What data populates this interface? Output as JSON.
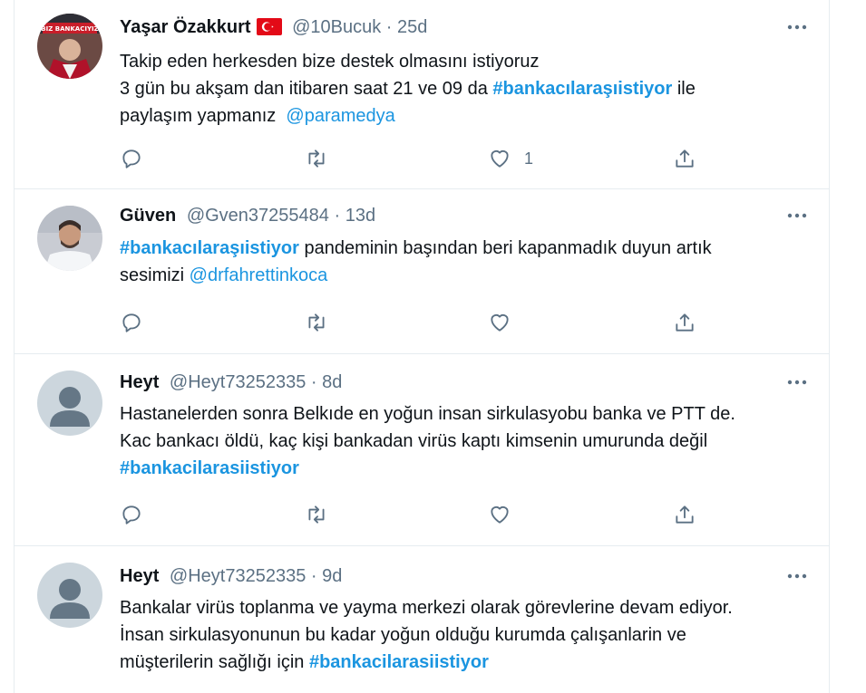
{
  "colors": {
    "link": "#1b95e0",
    "secondary": "#5b7083",
    "border": "#e6ecf0"
  },
  "tweets": [
    {
      "name": "Yaşar Özakkurt",
      "has_flag": true,
      "handle": "@10Bucuk",
      "time": "25d",
      "lines": [
        [
          {
            "t": "text",
            "v": "Takip eden herkesden bize destek olmasını istiyoruz"
          }
        ],
        [
          {
            "t": "text",
            "v": "3 gün bu akşam dan itibaren saat 21 ve 09 da "
          },
          {
            "t": "tag",
            "v": "#bankacılaraşıistiyor"
          },
          {
            "t": "text",
            "v": " ile"
          }
        ],
        [
          {
            "t": "text",
            "v": "paylaşım yapmanız  "
          },
          {
            "t": "mention",
            "v": "@paramedya"
          }
        ]
      ],
      "like_count": "1"
    },
    {
      "name": "Güven",
      "has_flag": false,
      "handle": "@Gven37255484",
      "time": "13d",
      "lines": [
        [
          {
            "t": "tag",
            "v": "#bankacılaraşıistiyor"
          },
          {
            "t": "text",
            "v": " pandeminin başından beri kapanmadık duyun artık"
          }
        ],
        [
          {
            "t": "text",
            "v": "sesimizi "
          },
          {
            "t": "mention",
            "v": "@drfahrettinkoca"
          }
        ]
      ],
      "like_count": ""
    },
    {
      "name": "Heyt",
      "has_flag": false,
      "handle": "@Heyt73252335",
      "time": "8d",
      "lines": [
        [
          {
            "t": "text",
            "v": "Hastanelerden sonra Belkıde en yoğun insan sirkulasyobu banka ve PTT de."
          }
        ],
        [
          {
            "t": "text",
            "v": "Kac bankacı öldü, kaç kişi bankadan virüs kaptı kimsenin umurunda değil"
          }
        ],
        [
          {
            "t": "tag",
            "v": "#bankacilarasiistiyor"
          }
        ]
      ],
      "like_count": ""
    },
    {
      "name": "Heyt",
      "has_flag": false,
      "handle": "@Heyt73252335",
      "time": "9d",
      "lines": [
        [
          {
            "t": "text",
            "v": "Bankalar virüs toplanma ve yayma merkezi olarak görevlerine devam ediyor."
          }
        ],
        [
          {
            "t": "text",
            "v": "İnsan sirkulasyonunun bu kadar yoğun olduğu kurumda çalışanlarin ve"
          }
        ],
        [
          {
            "t": "text",
            "v": "müşterilerin sağlığı için "
          },
          {
            "t": "tag",
            "v": "#bankacilarasiistiyor"
          }
        ]
      ],
      "like_count": ""
    }
  ]
}
